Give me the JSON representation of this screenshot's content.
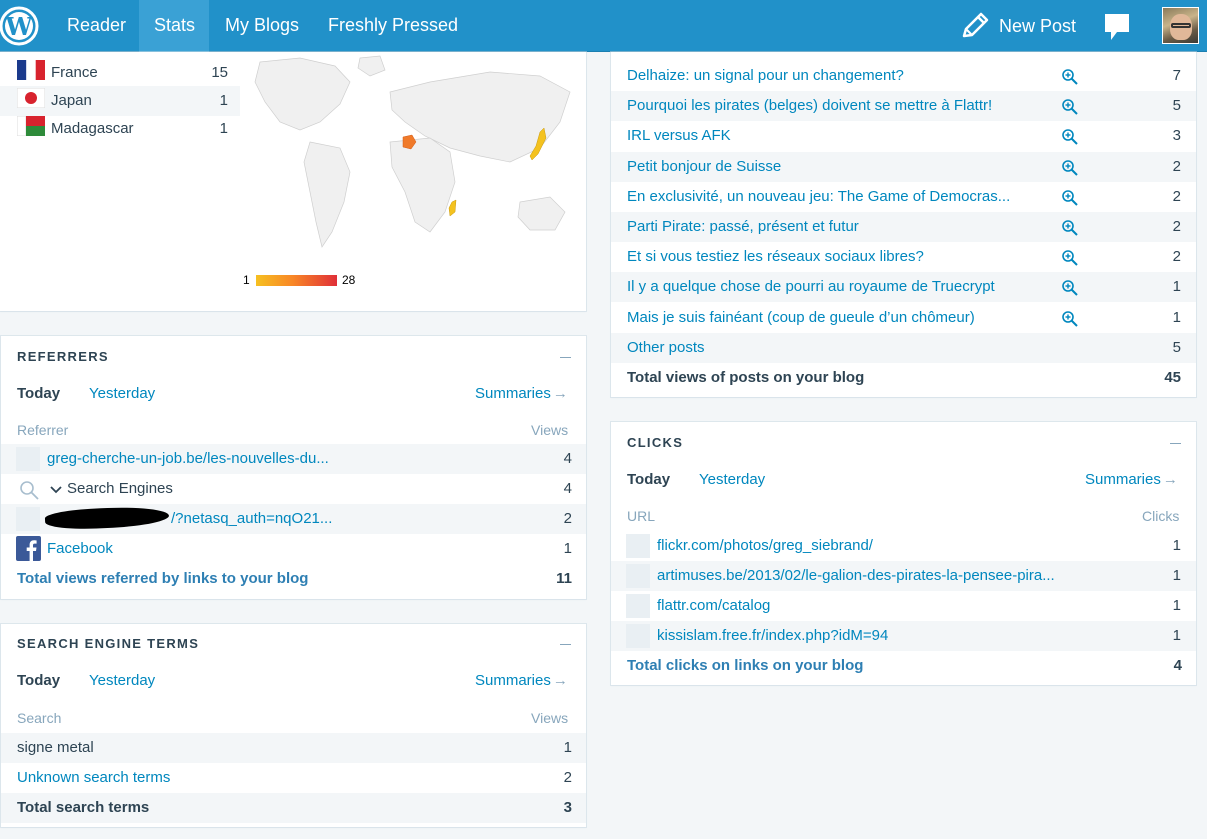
{
  "masterbar": {
    "nav": [
      "Reader",
      "Stats",
      "My Blogs",
      "Freshly Pressed"
    ],
    "new_post": "New Post",
    "colors": {
      "bar": "#2191c9",
      "active": "#3aa1d5"
    }
  },
  "countries": {
    "rows": [
      {
        "name": "France",
        "views": "15",
        "flag": "flag-france-icon"
      },
      {
        "name": "Japan",
        "views": "1",
        "flag": "flag-japan-icon"
      },
      {
        "name": "Madagascar",
        "views": "1",
        "flag": "flag-madagascar-icon"
      }
    ],
    "legend_min": "1",
    "legend_max": "28"
  },
  "posts": {
    "rows": [
      {
        "title": "Delhaize: un signal pour un changement?",
        "views": "7"
      },
      {
        "title": "Pourquoi les pirates (belges) doivent se mettre à Flattr!",
        "views": "5"
      },
      {
        "title": "IRL versus AFK",
        "views": "3"
      },
      {
        "title": "Petit bonjour de Suisse",
        "views": "2"
      },
      {
        "title": "En exclusivité, un nouveau jeu: The Game of Democras...",
        "views": "2"
      },
      {
        "title": "Parti Pirate: passé, présent et futur",
        "views": "2"
      },
      {
        "title": "Et si vous testiez les réseaux sociaux libres?",
        "views": "2"
      },
      {
        "title": "Il y a quelque chose de pourri au royaume de Truecrypt",
        "views": "1"
      },
      {
        "title": "Mais je suis fainéant (coup de gueule d’un chômeur)",
        "views": "1"
      }
    ],
    "other_label": "Other posts",
    "other_views": "5",
    "total_label": "Total views of posts on your blog",
    "total_views": "45"
  },
  "referrers": {
    "title": "Referrers",
    "tab_today": "Today",
    "tab_yesterday": "Yesterday",
    "summaries": "Summaries",
    "col_left": "Referrer",
    "col_right": "Views",
    "rows": [
      {
        "label": "greg-cherche-un-job.be/les-nouvelles-du...",
        "views": "4"
      },
      {
        "label": "Search Engines",
        "views": "4"
      },
      {
        "label": "/?netasq_auth=nqO21...",
        "views": "2"
      },
      {
        "label": "Facebook",
        "views": "1"
      }
    ],
    "total_label": "Total views referred by links to your blog",
    "total_views": "11"
  },
  "search_terms": {
    "title": "Search Engine Terms",
    "tab_today": "Today",
    "tab_yesterday": "Yesterday",
    "summaries": "Summaries",
    "col_left": "Search",
    "col_right": "Views",
    "rows": [
      {
        "label": "signe metal",
        "views": "1"
      },
      {
        "label": "Unknown search terms",
        "views": "2"
      }
    ],
    "total_label": "Total search terms",
    "total_views": "3"
  },
  "clicks": {
    "title": "Clicks",
    "tab_today": "Today",
    "tab_yesterday": "Yesterday",
    "summaries": "Summaries",
    "col_left": "URL",
    "col_right": "Clicks",
    "rows": [
      {
        "label": "flickr.com/photos/greg_siebrand/",
        "clicks": "1"
      },
      {
        "label": "artimuses.be/2013/02/le-galion-des-pirates-la-pensee-pira...",
        "clicks": "1"
      },
      {
        "label": "flattr.com/catalog",
        "clicks": "1"
      },
      {
        "label": "kissislam.free.fr/index.php?idM=94",
        "clicks": "1"
      }
    ],
    "total_label": "Total clicks on links on your blog",
    "total_clicks": "4"
  }
}
